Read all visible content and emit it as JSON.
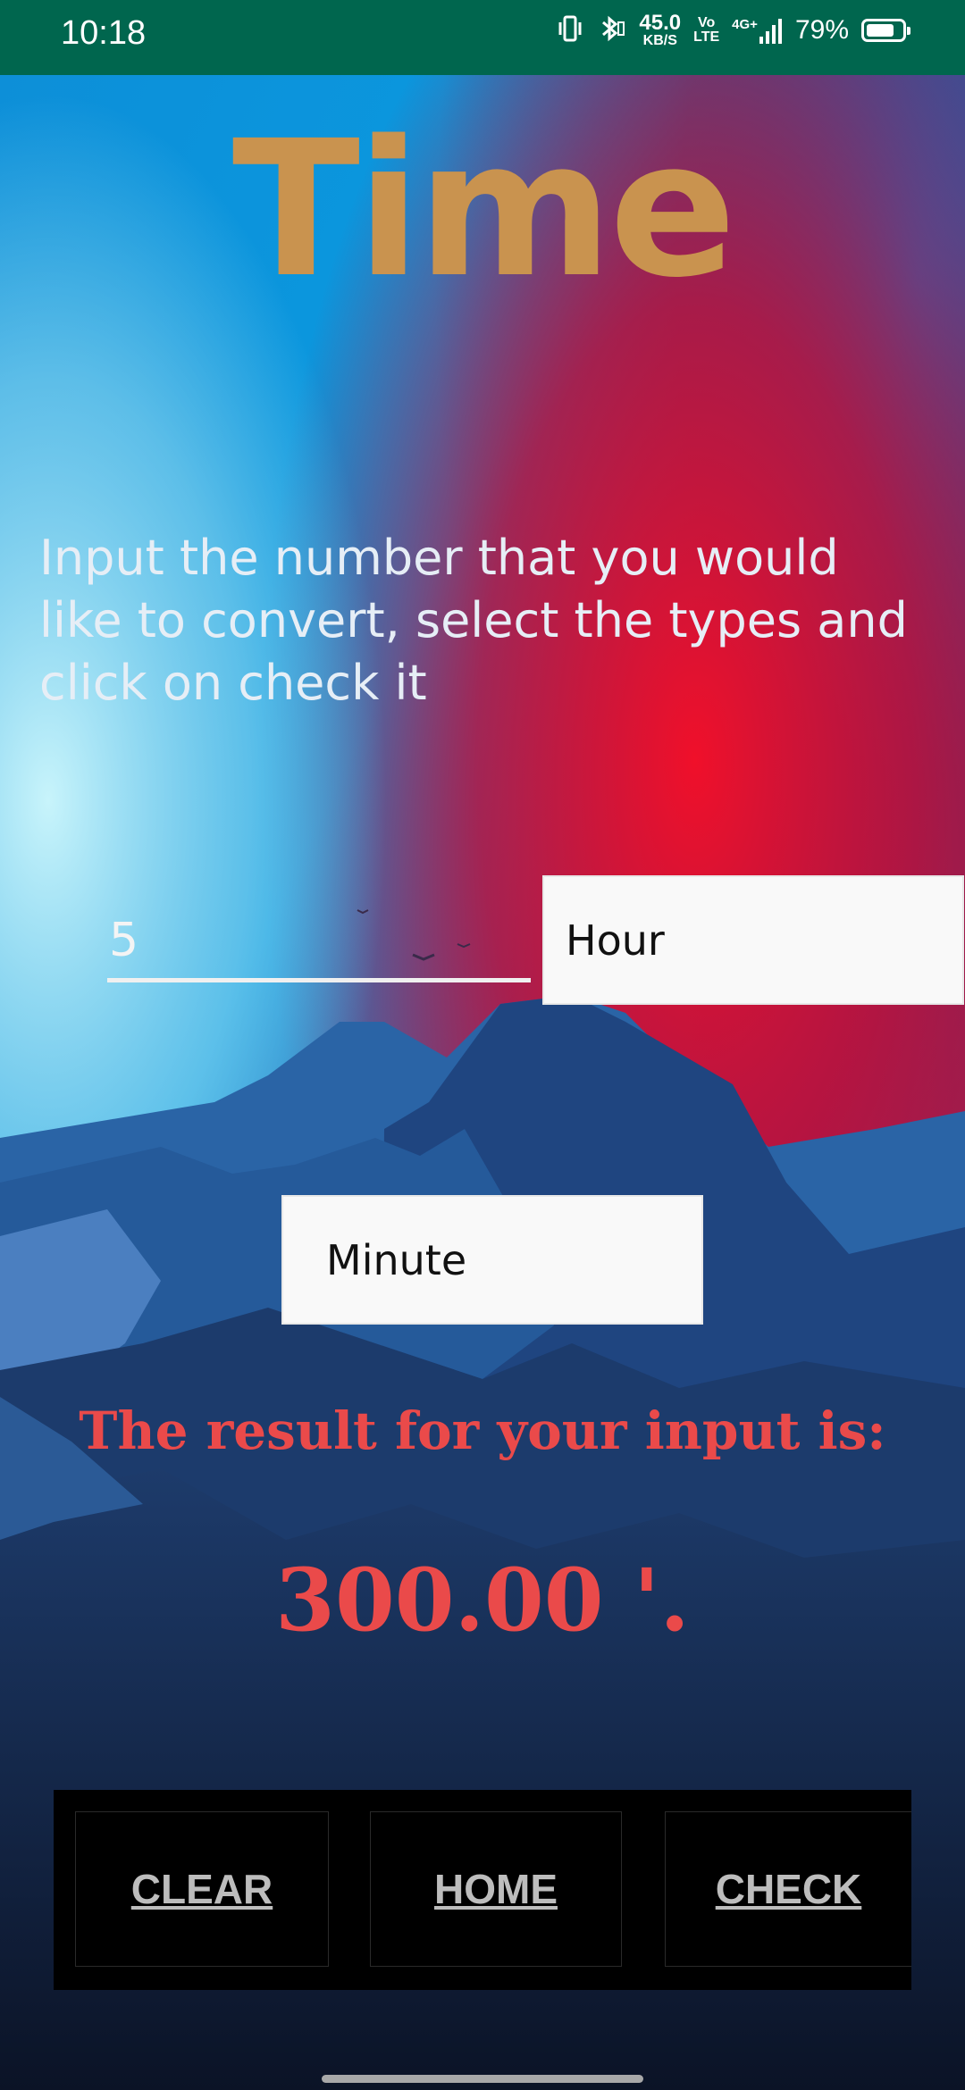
{
  "status_bar": {
    "time": "10:18",
    "net_speed_value": "45.0",
    "net_speed_unit": "KB/S",
    "volte_top": "Vo",
    "volte_bottom": "LTE",
    "network": "4G+",
    "battery_percent": "79%",
    "battery_level": 0.79,
    "icons": [
      "vibrate-icon",
      "bluetooth-icon",
      "signal-icon",
      "battery-icon"
    ]
  },
  "header": {
    "title": "Time"
  },
  "instructions": "Input the number that you would like to convert, select the types and click on check it",
  "converter": {
    "input_value": "5",
    "from_unit": "Hour",
    "to_unit": "Minute"
  },
  "result": {
    "label": "The result for your input is:",
    "value": "300.00 '."
  },
  "buttons": {
    "clear": "CLEAR",
    "home": "HOME",
    "check": "CHECK"
  },
  "colors": {
    "title": "#c9934f",
    "result": "#ea4a4a",
    "status_bar": "#00664e"
  }
}
